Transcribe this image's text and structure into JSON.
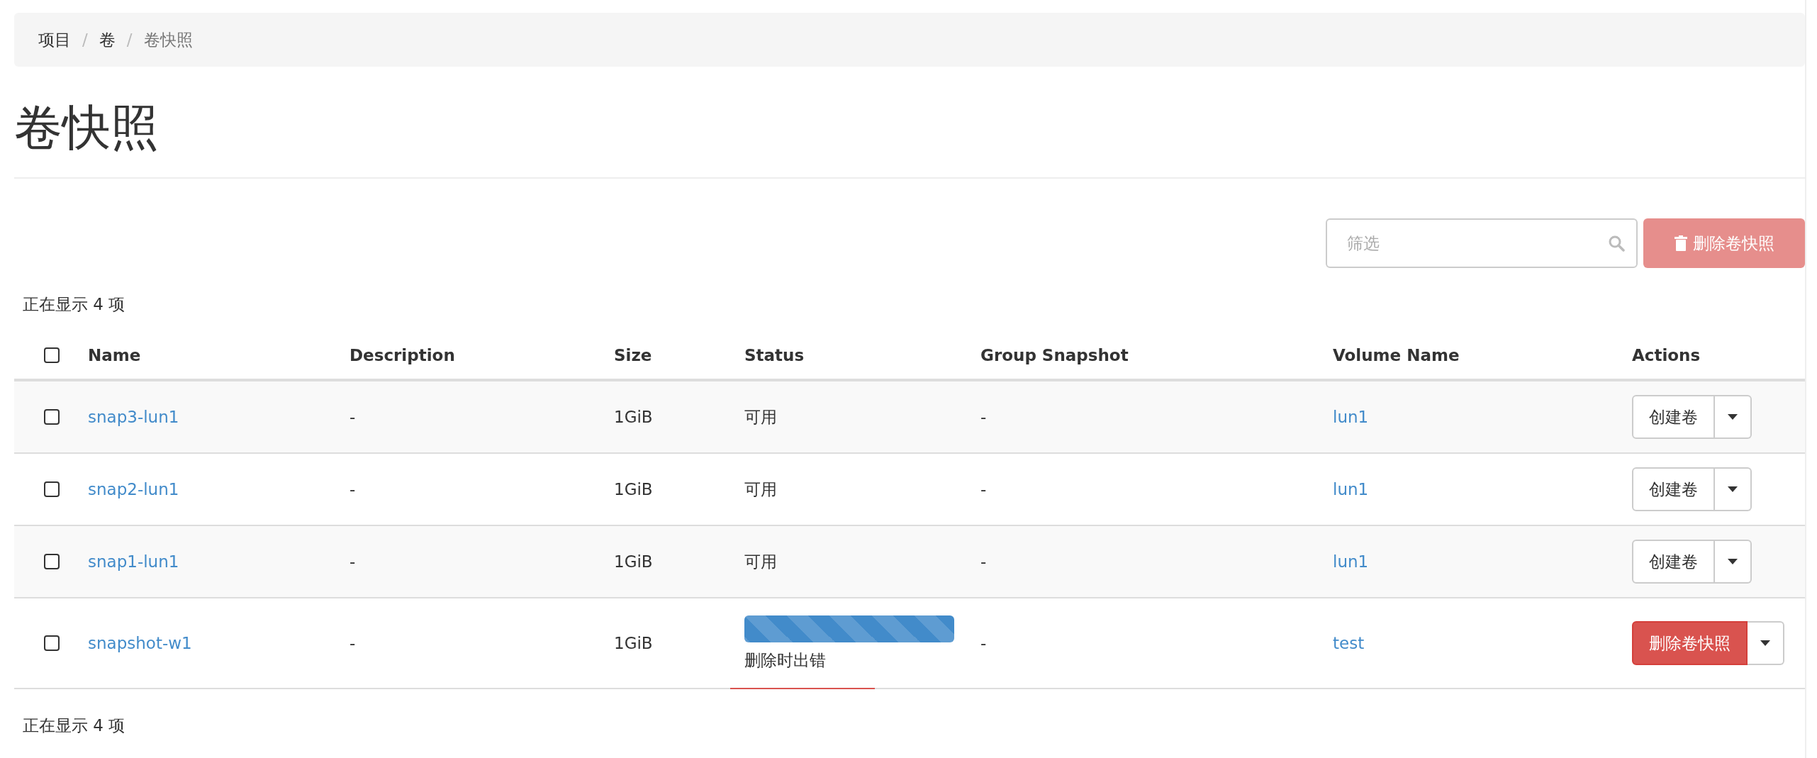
{
  "breadcrumb": {
    "separator": "/",
    "items": [
      {
        "label": "项目",
        "current": false
      },
      {
        "label": "卷",
        "current": false
      },
      {
        "label": "卷快照",
        "current": true
      }
    ]
  },
  "page_title": "卷快照",
  "toolbar": {
    "filter": {
      "placeholder": "筛选"
    },
    "delete_button": {
      "label": "删除卷快照",
      "disabled": true
    }
  },
  "count_top": "正在显示 4 项",
  "table": {
    "select_all": {
      "checked": false
    },
    "columns": [
      "Name",
      "Description",
      "Size",
      "Status",
      "Group Snapshot",
      "Volume Name",
      "Actions"
    ],
    "rows": [
      {
        "checked": false,
        "name": "snap3-lun1",
        "description": "-",
        "size": "1GiB",
        "status": {
          "kind": "text",
          "label": "可用",
          "error": false
        },
        "group": "-",
        "volume": "lun1",
        "action": {
          "label": "创建卷",
          "kind": "default"
        }
      },
      {
        "checked": false,
        "name": "snap2-lun1",
        "description": "-",
        "size": "1GiB",
        "status": {
          "kind": "text",
          "label": "可用",
          "error": false
        },
        "group": "-",
        "volume": "lun1",
        "action": {
          "label": "创建卷",
          "kind": "default"
        }
      },
      {
        "checked": false,
        "name": "snap1-lun1",
        "description": "-",
        "size": "1GiB",
        "status": {
          "kind": "text",
          "label": "可用",
          "error": false
        },
        "group": "-",
        "volume": "lun1",
        "action": {
          "label": "创建卷",
          "kind": "default"
        }
      },
      {
        "checked": false,
        "name": "snapshot-w1",
        "description": "-",
        "size": "1GiB",
        "status": {
          "kind": "progress",
          "label": "删除时出错",
          "level": 1,
          "error": true
        },
        "group": "-",
        "volume": "test",
        "action": {
          "label": "删除卷快照",
          "kind": "danger"
        }
      }
    ]
  },
  "count_bottom": "正在显示 4 项"
}
